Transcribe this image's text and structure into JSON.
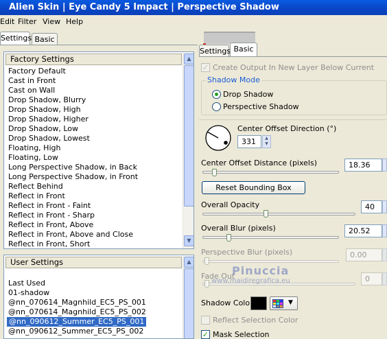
{
  "window": {
    "title": "Alien Skin  |  Eye Candy 5 Impact  |  Perspective Shadow"
  },
  "menu": [
    "Edit",
    "Filter",
    "View",
    "Help"
  ],
  "left_tabs": [
    "Settings",
    "Basic"
  ],
  "factory": {
    "header": "Factory Settings",
    "items": [
      "Factory Default",
      "Cast in Front",
      "Cast on Wall",
      "Drop Shadow, Blurry",
      "Drop Shadow, High",
      "Drop Shadow, Higher",
      "Drop Shadow, Low",
      "Drop Shadow, Lowest",
      "Floating, High",
      "Floating, Low",
      "Long Perspective Shadow, in Back",
      "Long Perspective Shadow, in Front",
      "Reflect Behind",
      "Reflect in Front",
      "Reflect in Front - Faint",
      "Reflect in Front - Sharp",
      "Reflect in Front, Above",
      "Reflect in Front, Above and Close",
      "Reflect in Front, Short"
    ]
  },
  "user": {
    "header": "User Settings",
    "items": [
      "Last Used",
      "01-shadow",
      "@nn_070614_Magnhild_EC5_PS_001",
      "@nn_070614_Magnhild_EC5_PS_002",
      "@nn_090612_Summer_EC5_PS_001",
      "@nn_090612_Summer_EC5_PS_002"
    ],
    "selected_index": 4
  },
  "right_tabs": [
    "Settings",
    "Basic"
  ],
  "create_output": "Create Output In New Layer Below Current",
  "shadow_mode": {
    "label": "Shadow Mode",
    "options": [
      "Drop Shadow",
      "Perspective Shadow"
    ],
    "selected": "Drop Shadow"
  },
  "center_offset_direction": {
    "label": "Center Offset Direction (°)",
    "value": "331"
  },
  "center_offset_distance": {
    "label": "Center Offset Distance (pixels)",
    "value": "18.36"
  },
  "reset_button": "Reset Bounding Box",
  "overall_opacity": {
    "label": "Overall Opacity",
    "value": "40"
  },
  "overall_blur": {
    "label": "Overall Blur (pixels)",
    "value": "20.52"
  },
  "perspective_blur": {
    "label": "Perspective Blur (pixels)",
    "value": "0.00"
  },
  "fade_out": {
    "label": "Fade Out",
    "value": "0"
  },
  "shadow_color": {
    "label": "Shadow Color",
    "swatch": "#000000"
  },
  "reflect_selection_color": "Reflect Selection Color",
  "mask_selection": "Mask Selection",
  "watermark": {
    "name": "Pinuccia",
    "site": "www.maidiregrafica.eu"
  },
  "colors": {
    "title_bar": "#0a47c8",
    "selection": "#316ac5",
    "accent_green": "#21a121"
  }
}
